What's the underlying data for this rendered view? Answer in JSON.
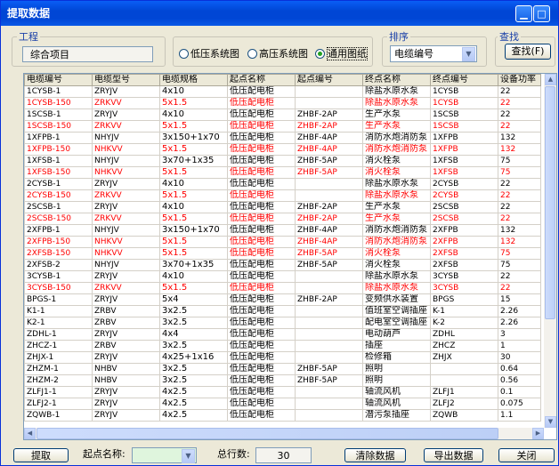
{
  "window": {
    "title": "提取数据"
  },
  "project": {
    "group_label": "工程",
    "value": "综合项目"
  },
  "diagram_type": {
    "options": [
      {
        "label": "低压系统图",
        "selected": false
      },
      {
        "label": "高压系统图",
        "selected": false
      },
      {
        "label": "通用图纸",
        "selected": true
      }
    ]
  },
  "sort": {
    "group_label": "排序",
    "selected": "电缆编号"
  },
  "search": {
    "group_label": "查找",
    "button_label": "查找(F)"
  },
  "table": {
    "columns": [
      "电缆编号",
      "电缆型号",
      "电缆规格",
      "起点名称",
      "起点编号",
      "终点名称",
      "终点编号",
      "设备功率"
    ],
    "rows": [
      {
        "cells": [
          "1CYSB-1",
          "ZRYJV",
          "4x10",
          "低压配电柜",
          "",
          "除盐水原水泵",
          "1CYSB",
          "22"
        ],
        "red": false
      },
      {
        "cells": [
          "1CYSB-150",
          "ZRKVV",
          "5x1.5",
          "低压配电柜",
          "",
          "除盐水原水泵",
          "1CYSB",
          "22"
        ],
        "red": true
      },
      {
        "cells": [
          "1SCSB-1",
          "ZRYJV",
          "4x10",
          "低压配电柜",
          "ZHBF-2AP",
          "生产水泵",
          "1SCSB",
          "22"
        ],
        "red": false
      },
      {
        "cells": [
          "1SCSB-150",
          "ZRKVV",
          "5x1.5",
          "低压配电柜",
          "ZHBF-2AP",
          "生产水泵",
          "1SCSB",
          "22"
        ],
        "red": true
      },
      {
        "cells": [
          "1XFPB-1",
          "NHYJV",
          "3x150+1x70",
          "低压配电柜",
          "ZHBF-4AP",
          "消防水炮消防泵",
          "1XFPB",
          "132"
        ],
        "red": false
      },
      {
        "cells": [
          "1XFPB-150",
          "NHKVV",
          "5x1.5",
          "低压配电柜",
          "ZHBF-4AP",
          "消防水炮消防泵",
          "1XFPB",
          "132"
        ],
        "red": true
      },
      {
        "cells": [
          "1XFSB-1",
          "NHYJV",
          "3x70+1x35",
          "低压配电柜",
          "ZHBF-5AP",
          "消火栓泵",
          "1XFSB",
          "75"
        ],
        "red": false
      },
      {
        "cells": [
          "1XFSB-150",
          "NHKVV",
          "5x1.5",
          "低压配电柜",
          "ZHBF-5AP",
          "消火栓泵",
          "1XFSB",
          "75"
        ],
        "red": true
      },
      {
        "cells": [
          "2CYSB-1",
          "ZRYJV",
          "4x10",
          "低压配电柜",
          "",
          "除盐水原水泵",
          "2CYSB",
          "22"
        ],
        "red": false
      },
      {
        "cells": [
          "2CYSB-150",
          "ZRKVV",
          "5x1.5",
          "低压配电柜",
          "",
          "除盐水原水泵",
          "2CYSB",
          "22"
        ],
        "red": true
      },
      {
        "cells": [
          "2SCSB-1",
          "ZRYJV",
          "4x10",
          "低压配电柜",
          "ZHBF-2AP",
          "生产水泵",
          "2SCSB",
          "22"
        ],
        "red": false
      },
      {
        "cells": [
          "2SCSB-150",
          "ZRKVV",
          "5x1.5",
          "低压配电柜",
          "ZHBF-2AP",
          "生产水泵",
          "2SCSB",
          "22"
        ],
        "red": true
      },
      {
        "cells": [
          "2XFPB-1",
          "NHYJV",
          "3x150+1x70",
          "低压配电柜",
          "ZHBF-4AP",
          "消防水炮消防泵",
          "2XFPB",
          "132"
        ],
        "red": false
      },
      {
        "cells": [
          "2XFPB-150",
          "NHKVV",
          "5x1.5",
          "低压配电柜",
          "ZHBF-4AP",
          "消防水炮消防泵",
          "2XFPB",
          "132"
        ],
        "red": true
      },
      {
        "cells": [
          "2XFSB-150",
          "NHKVV",
          "5x1.5",
          "低压配电柜",
          "ZHBF-5AP",
          "消火栓泵",
          "2XFSB",
          "75"
        ],
        "red": true
      },
      {
        "cells": [
          "2XFSB-2",
          "NHYJV",
          "3x70+1x35",
          "低压配电柜",
          "ZHBF-5AP",
          "消火栓泵",
          "2XFSB",
          "75"
        ],
        "red": false
      },
      {
        "cells": [
          "3CYSB-1",
          "ZRYJV",
          "4x10",
          "低压配电柜",
          "",
          "除盐水原水泵",
          "3CYSB",
          "22"
        ],
        "red": false
      },
      {
        "cells": [
          "3CYSB-150",
          "ZRKVV",
          "5x1.5",
          "低压配电柜",
          "",
          "除盐水原水泵",
          "3CYSB",
          "22"
        ],
        "red": true
      },
      {
        "cells": [
          "BPGS-1",
          "ZRYJV",
          "5x4",
          "低压配电柜",
          "ZHBF-2AP",
          "变频供水装置",
          "BPGS",
          "15"
        ],
        "red": false
      },
      {
        "cells": [
          "K1-1",
          "ZRBV",
          "3x2.5",
          "低压配电柜",
          "",
          "值班室空调插座",
          "K-1",
          "2.26"
        ],
        "red": false
      },
      {
        "cells": [
          "K2-1",
          "ZRBV",
          "3x2.5",
          "低压配电柜",
          "",
          "配电室空调插座",
          "K-2",
          "2.26"
        ],
        "red": false
      },
      {
        "cells": [
          "ZDHL-1",
          "ZRYJV",
          "4x4",
          "低压配电柜",
          "",
          "电动葫芦",
          "ZDHL",
          "3"
        ],
        "red": false
      },
      {
        "cells": [
          "ZHCZ-1",
          "ZRBV",
          "3x2.5",
          "低压配电柜",
          "",
          "插座",
          "ZHCZ",
          "1"
        ],
        "red": false
      },
      {
        "cells": [
          "ZHJX-1",
          "ZRYJV",
          "4x25+1x16",
          "低压配电柜",
          "",
          "检修箱",
          "ZHJX",
          "30"
        ],
        "red": false
      },
      {
        "cells": [
          "ZHZM-1",
          "NHBV",
          "3x2.5",
          "低压配电柜",
          "ZHBF-5AP",
          "照明",
          "",
          "0.64"
        ],
        "red": false
      },
      {
        "cells": [
          "ZHZM-2",
          "NHBV",
          "3x2.5",
          "低压配电柜",
          "ZHBF-5AP",
          "照明",
          "",
          "0.56"
        ],
        "red": false
      },
      {
        "cells": [
          "ZLFJ1-1",
          "ZRYJV",
          "4x2.5",
          "低压配电柜",
          "",
          "轴流风机",
          "ZLFJ1",
          "0.1"
        ],
        "red": false
      },
      {
        "cells": [
          "ZLFJ2-1",
          "ZRYJV",
          "4x2.5",
          "低压配电柜",
          "",
          "轴流风机",
          "ZLFJ2",
          "0.075"
        ],
        "red": false
      },
      {
        "cells": [
          "ZQWB-1",
          "ZRYJV",
          "4x2.5",
          "低压配电柜",
          "",
          "潜污泵插座",
          "ZQWB",
          "1.1"
        ],
        "red": false
      }
    ]
  },
  "footer": {
    "extract_button": "提取",
    "start_name_label": "起点名称:",
    "start_name_value": "",
    "total_label": "总行数:",
    "total_value": "30",
    "clear_button": "清除数据",
    "export_button": "导出数据",
    "close_button": "关闭"
  },
  "colors": {
    "title_bar": "#0046d5",
    "highlight_text": "#ff0000",
    "group_label": "#1a40a8"
  }
}
